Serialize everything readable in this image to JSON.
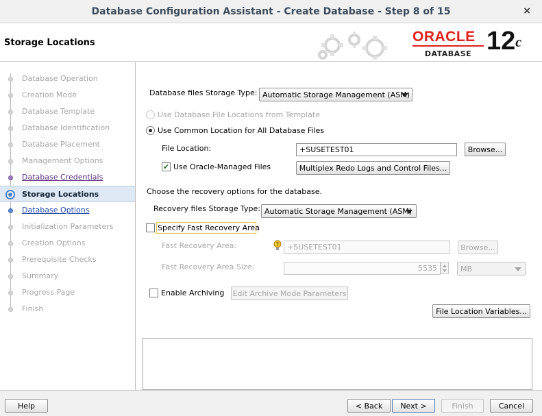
{
  "window": {
    "title": "Database Configuration Assistant - Create Database - Step 8 of 15",
    "close_glyph": "×"
  },
  "header": {
    "page_title": "Storage Locations",
    "logo": {
      "brand": "ORACLE",
      "product": "DATABASE",
      "version": "12",
      "version_suffix": "c"
    }
  },
  "sidebar": {
    "steps": [
      {
        "label": "Database Operation",
        "state": "done-dim"
      },
      {
        "label": "Creation Mode",
        "state": "done-dim"
      },
      {
        "label": "Database Template",
        "state": "done-dim"
      },
      {
        "label": "Database Identification",
        "state": "done-dim"
      },
      {
        "label": "Database Placement",
        "state": "done-dim"
      },
      {
        "label": "Management Options",
        "state": "done-dim"
      },
      {
        "label": "Database Credentials",
        "state": "visited"
      },
      {
        "label": "Storage Locations",
        "state": "active"
      },
      {
        "label": "Database Options",
        "state": "next"
      },
      {
        "label": "Initialization Parameters",
        "state": "pending"
      },
      {
        "label": "Creation Options",
        "state": "pending"
      },
      {
        "label": "Prerequisite Checks",
        "state": "pending"
      },
      {
        "label": "Summary",
        "state": "pending"
      },
      {
        "label": "Progress Page",
        "state": "pending"
      },
      {
        "label": "Finish",
        "state": "pending"
      }
    ]
  },
  "main": {
    "storage_type": {
      "label": "Database files Storage Type:",
      "value": "Automatic Storage Management (ASM)"
    },
    "radio_template": {
      "label": "Use Database File Locations from Template",
      "selected": false,
      "enabled": false
    },
    "radio_common": {
      "label": "Use Common Location for All Database Files",
      "selected": true
    },
    "file_location": {
      "label": "File Location:",
      "value": "+SUSETEST01",
      "browse_label": "Browse..."
    },
    "omf": {
      "label": "Use Oracle-Managed Files",
      "checked": true,
      "check_glyph": "✔",
      "multiplex_label": "Multiplex Redo Logs and Control Files..."
    },
    "recovery_heading": "Choose the recovery options for the database.",
    "recovery_type": {
      "label": "Recovery files Storage Type:",
      "value": "Automatic Storage Management (ASM)"
    },
    "fra": {
      "label": "Specify Fast Recovery Area",
      "checked": false
    },
    "fra_location": {
      "label": "Fast Recovery Area:",
      "value": "+SUSETEST01",
      "browse_label": "Browse..."
    },
    "fra_size": {
      "label": "Fast Recovery Area Size:",
      "value": "5535",
      "unit": "MB"
    },
    "archiving": {
      "label": "Enable Archiving",
      "checked": false,
      "edit_label": "Edit Archive Mode Parameters"
    },
    "variables_label": "File Location Variables..."
  },
  "footer": {
    "help": "Help",
    "back": "< Back",
    "next": "Next >",
    "finish": "Finish",
    "cancel": "Cancel"
  },
  "colors": {
    "oracle_red": "#e0201b",
    "active_step_bg": "#dfe9f5",
    "link_blue": "#1f4aa8",
    "visited_purple": "#5a2a80"
  }
}
